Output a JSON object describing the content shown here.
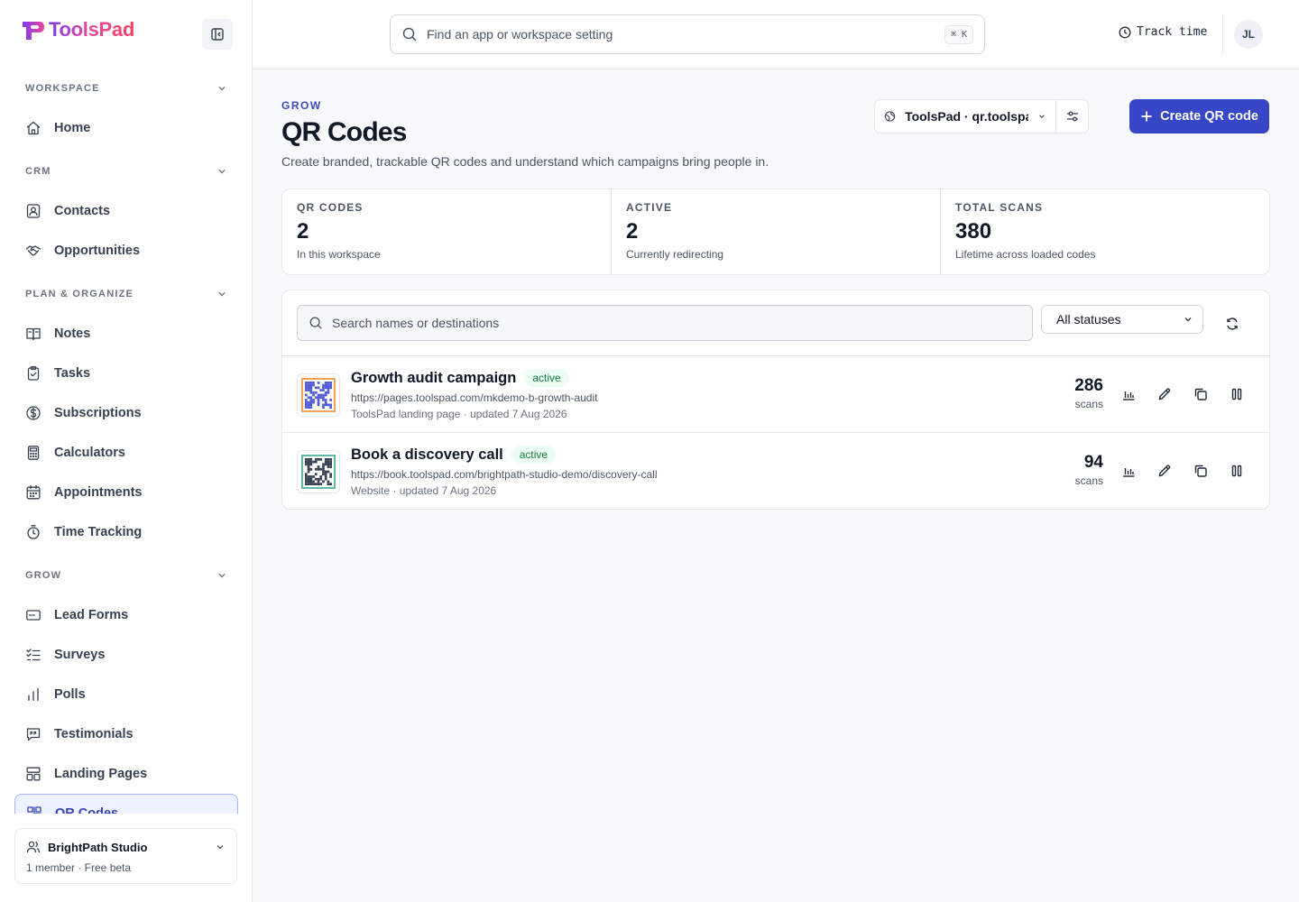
{
  "app": {
    "name": "ToolsPad"
  },
  "sidebar": {
    "sections": [
      {
        "label": "WORKSPACE",
        "items": [
          {
            "label": "Home",
            "icon": "home-icon"
          }
        ]
      },
      {
        "label": "CRM",
        "items": [
          {
            "label": "Contacts",
            "icon": "contact-card-icon"
          },
          {
            "label": "Opportunities",
            "icon": "handshake-icon"
          }
        ]
      },
      {
        "label": "PLAN & ORGANIZE",
        "items": [
          {
            "label": "Notes",
            "icon": "book-icon"
          },
          {
            "label": "Tasks",
            "icon": "clipboard-check-icon"
          },
          {
            "label": "Subscriptions",
            "icon": "dollar-circle-icon"
          },
          {
            "label": "Calculators",
            "icon": "calculator-icon"
          },
          {
            "label": "Appointments",
            "icon": "calendar-icon"
          },
          {
            "label": "Time Tracking",
            "icon": "stopwatch-icon"
          }
        ]
      },
      {
        "label": "GROW",
        "items": [
          {
            "label": "Lead Forms",
            "icon": "form-icon"
          },
          {
            "label": "Surveys",
            "icon": "checklist-icon"
          },
          {
            "label": "Polls",
            "icon": "bar-chart-icon"
          },
          {
            "label": "Testimonials",
            "icon": "message-quote-icon"
          },
          {
            "label": "Landing Pages",
            "icon": "layout-icon"
          },
          {
            "label": "QR Codes",
            "icon": "qr-code-icon",
            "active": true
          }
        ]
      }
    ],
    "workspace": {
      "name": "BrightPath Studio",
      "sub": "1 member · Free beta"
    }
  },
  "topbar": {
    "search_placeholder": "Find an app or workspace setting",
    "shortcut": "⌘ K",
    "track_time": "Track time",
    "avatar_initials": "JL"
  },
  "page": {
    "eyebrow": "GROW",
    "title": "QR Codes",
    "subtitle": "Create branded, trackable QR codes and understand which campaigns bring people in.",
    "domain": "ToolsPad · qr.toolspad.com",
    "create_label": "Create QR code"
  },
  "stats": [
    {
      "label": "QR CODES",
      "value": "2",
      "note": "In this workspace"
    },
    {
      "label": "ACTIVE",
      "value": "2",
      "note": "Currently redirecting"
    },
    {
      "label": "TOTAL SCANS",
      "value": "380",
      "note": "Lifetime across loaded codes"
    }
  ],
  "filters": {
    "search_placeholder": "Search names or destinations",
    "status": "All statuses"
  },
  "codes": [
    {
      "name": "Growth audit campaign",
      "status": "active",
      "url": "https://pages.toolspad.com/mkdemo-b-growth-audit",
      "meta": "ToolsPad landing page · updated 7 Aug 2026",
      "scans": "286",
      "scans_label": "scans",
      "frame_color": "#f2a25a",
      "dot_color": "#4f5bd5"
    },
    {
      "name": "Book a discovery call",
      "status": "active",
      "url": "https://book.toolspad.com/brightpath-studio-demo/discovery-call",
      "meta": "Website · updated 7 Aug 2026",
      "scans": "94",
      "scans_label": "scans",
      "frame_color": "#5fb9a6",
      "dot_color": "#374151"
    }
  ]
}
